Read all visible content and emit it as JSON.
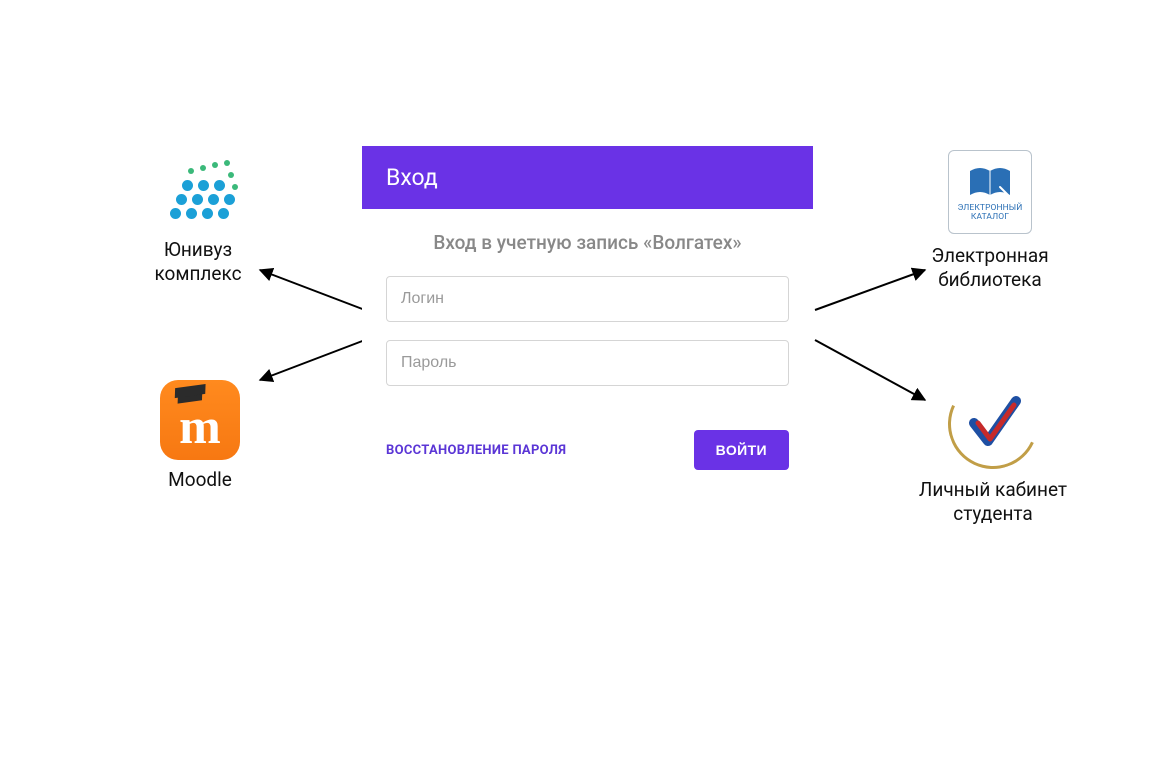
{
  "login": {
    "header": "Вход",
    "subtitle": "Вход в учетную запись «Волгатех»",
    "login_placeholder": "Логин",
    "password_placeholder": "Пароль",
    "recover_label": "ВОССТАНОВЛЕНИЕ ПАРОЛЯ",
    "submit_label": "ВОЙТИ"
  },
  "satellites": {
    "univuz_label": "Юнивуз\nкомплекс",
    "moodle_label": "Moodle",
    "library_label": "Электронная\nбиблиотека",
    "catalog_line1": "ЭЛЕКТРОННЫЙ",
    "catalog_line2": "КАТАЛОГ",
    "cabinet_label": "Личный кабинет\nстудента"
  }
}
